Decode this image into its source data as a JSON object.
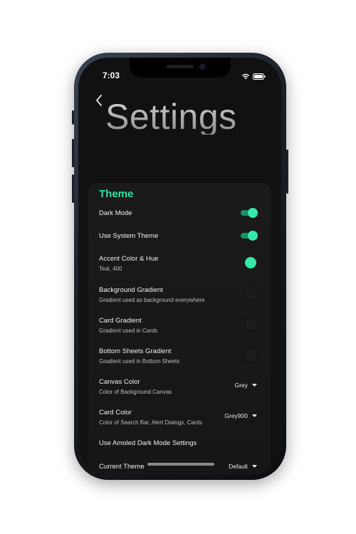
{
  "status_bar": {
    "time": "7:03"
  },
  "header": {
    "title": "Settings"
  },
  "section": {
    "title": "Theme"
  },
  "settings": [
    {
      "title": "Dark Mode",
      "subtitle": "",
      "control": "toggle",
      "on": true
    },
    {
      "title": "Use System Theme",
      "subtitle": "",
      "control": "toggle",
      "on": true
    },
    {
      "title": "Accent Color & Hue",
      "subtitle": "Teal, 400",
      "control": "color-dot"
    },
    {
      "title": "Background Gradient",
      "subtitle": "Gradient used as background everywhere",
      "control": "toggle",
      "on": false
    },
    {
      "title": "Card Gradient",
      "subtitle": "Gradient used in Cards",
      "control": "toggle",
      "on": false
    },
    {
      "title": "Bottom Sheets Gradient",
      "subtitle": "Gradient used in Bottom Sheets",
      "control": "toggle",
      "on": false
    },
    {
      "title": "Canvas Color",
      "subtitle": "Color of Background Canvas",
      "control": "dropdown",
      "value": "Grey"
    },
    {
      "title": "Card Color",
      "subtitle": "Color of Search Bar, Alert Dialogs, Cards",
      "control": "dropdown",
      "value": "Grey900"
    },
    {
      "title": "Use Amoled Dark Mode Settings",
      "subtitle": "",
      "control": "none"
    },
    {
      "title": "Current Theme",
      "subtitle": "",
      "control": "dropdown",
      "value": "Default"
    }
  ],
  "colors": {
    "accent": "#35e8a8",
    "section_title": "#2fe0a0",
    "background": "#111111",
    "card": "#181818"
  },
  "icons": {
    "back": "chevron-left-icon",
    "wifi": "wifi-icon",
    "battery": "battery-icon",
    "dropdown": "caret-down-icon"
  }
}
